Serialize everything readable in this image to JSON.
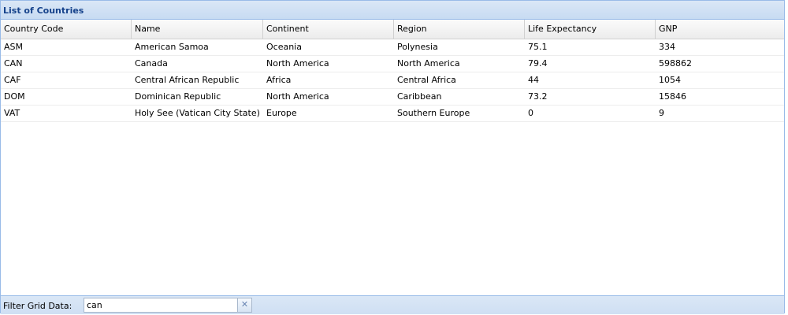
{
  "panel": {
    "title": "List of Countries"
  },
  "grid": {
    "columns": [
      "Country Code",
      "Name",
      "Continent",
      "Region",
      "Life Expectancy",
      "GNP"
    ],
    "rows": [
      [
        "ASM",
        "American Samoa",
        "Oceania",
        "Polynesia",
        "75.1",
        "334"
      ],
      [
        "CAN",
        "Canada",
        "North America",
        "North America",
        "79.4",
        "598862"
      ],
      [
        "CAF",
        "Central African Republic",
        "Africa",
        "Central Africa",
        "44",
        "1054"
      ],
      [
        "DOM",
        "Dominican Republic",
        "North America",
        "Caribbean",
        "73.2",
        "15846"
      ],
      [
        "VAT",
        "Holy See (Vatican City State)",
        "Europe",
        "Southern Europe",
        "0",
        "9"
      ]
    ]
  },
  "filter": {
    "label": "Filter Grid Data:",
    "value": "can",
    "clear_icon": "close-icon"
  },
  "colors": {
    "header_title": "#15428b",
    "panel_border": "#99bbe8"
  }
}
